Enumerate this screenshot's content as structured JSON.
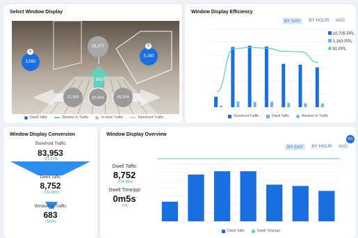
{
  "cards": {
    "select_window": {
      "title": "Select Window Display"
    },
    "efficiency": {
      "title": "Window Display Efficiency"
    },
    "conversion": {
      "title": "Window Display Conversion"
    },
    "overview": {
      "title": "Window Display Overview"
    }
  },
  "tabs": {
    "by_day": "BY DAY",
    "by_hour": "BY HOUR",
    "avg": "AVG"
  },
  "camera": {
    "badges": [
      {
        "id": "A",
        "value": "3,592"
      },
      {
        "id": "B",
        "value": "5,160"
      }
    ],
    "bubbles": {
      "top": "29,377",
      "arrow": "663",
      "left": "21,950",
      "center": "87,054",
      "right": "45,204"
    },
    "legend": [
      "Dwell Taffic",
      "Window In Traffic",
      "In-store Traffic",
      "Storefront Traffic"
    ]
  },
  "efficiency_legend": {
    "side": [
      "10,705 PPL",
      "1,163 PPL",
      "91 PPL"
    ],
    "bottom": [
      "Storefront Traffic",
      "Dwell Taffic",
      "Window In Traffic"
    ]
  },
  "conversion": {
    "storefront_label": "Storefront Traffic",
    "storefront_value": "83,953",
    "storefront_change": "↑21.27%",
    "dwell_label": "Dwell Taffic",
    "dwell_value": "8,752",
    "dwell_change": "↑274.98%",
    "window_label": "Window In Traffic",
    "window_value": "683",
    "window_change": "↑583%"
  },
  "overview": {
    "dwell_label": "Dwell Taffic",
    "dwell_value": "8,752",
    "dwell_change": "↑274.98%",
    "time_label": "Dwell Time/ppl",
    "time_value": "0m5s",
    "time_change": "↑0%",
    "legend": [
      "Dwell Taffic",
      "Dwell Time/ppl"
    ],
    "corner_badge": "AG"
  },
  "colors": {
    "blue": "#1a6fe0",
    "light_blue": "#6cb4f0",
    "teal": "#53d1c4",
    "green": "#2bb673"
  },
  "chart_data": [
    {
      "type": "bar",
      "name": "efficiency",
      "categories": [
        "",
        "",
        "",
        "",
        "",
        "",
        ""
      ],
      "series": [
        {
          "name": "Storefront Traffic",
          "values": [
            2400,
            13900,
            14200,
            14000,
            10000,
            9800,
            9200
          ]
        },
        {
          "name": "Dwell Taffic",
          "values": [
            350,
            1300,
            1200,
            1250,
            1000,
            900,
            850
          ]
        },
        {
          "name": "Window In Traffic",
          "values": [
            3500,
            13500,
            13800,
            13600,
            12900,
            12800,
            10300
          ]
        }
      ],
      "ylim": [
        0,
        18000
      ]
    },
    {
      "type": "bar",
      "name": "overview",
      "categories": [
        "",
        "",
        "",
        "",
        "",
        "",
        ""
      ],
      "series": [
        {
          "name": "Dwell Taffic",
          "values": [
            600,
            1430,
            1530,
            1530,
            1120,
            1080,
            930
          ]
        },
        {
          "name": "Dwell Time/ppl",
          "values": [
            5,
            5,
            5,
            5,
            5,
            5,
            5
          ]
        }
      ],
      "ylim": [
        0,
        2000
      ]
    }
  ]
}
